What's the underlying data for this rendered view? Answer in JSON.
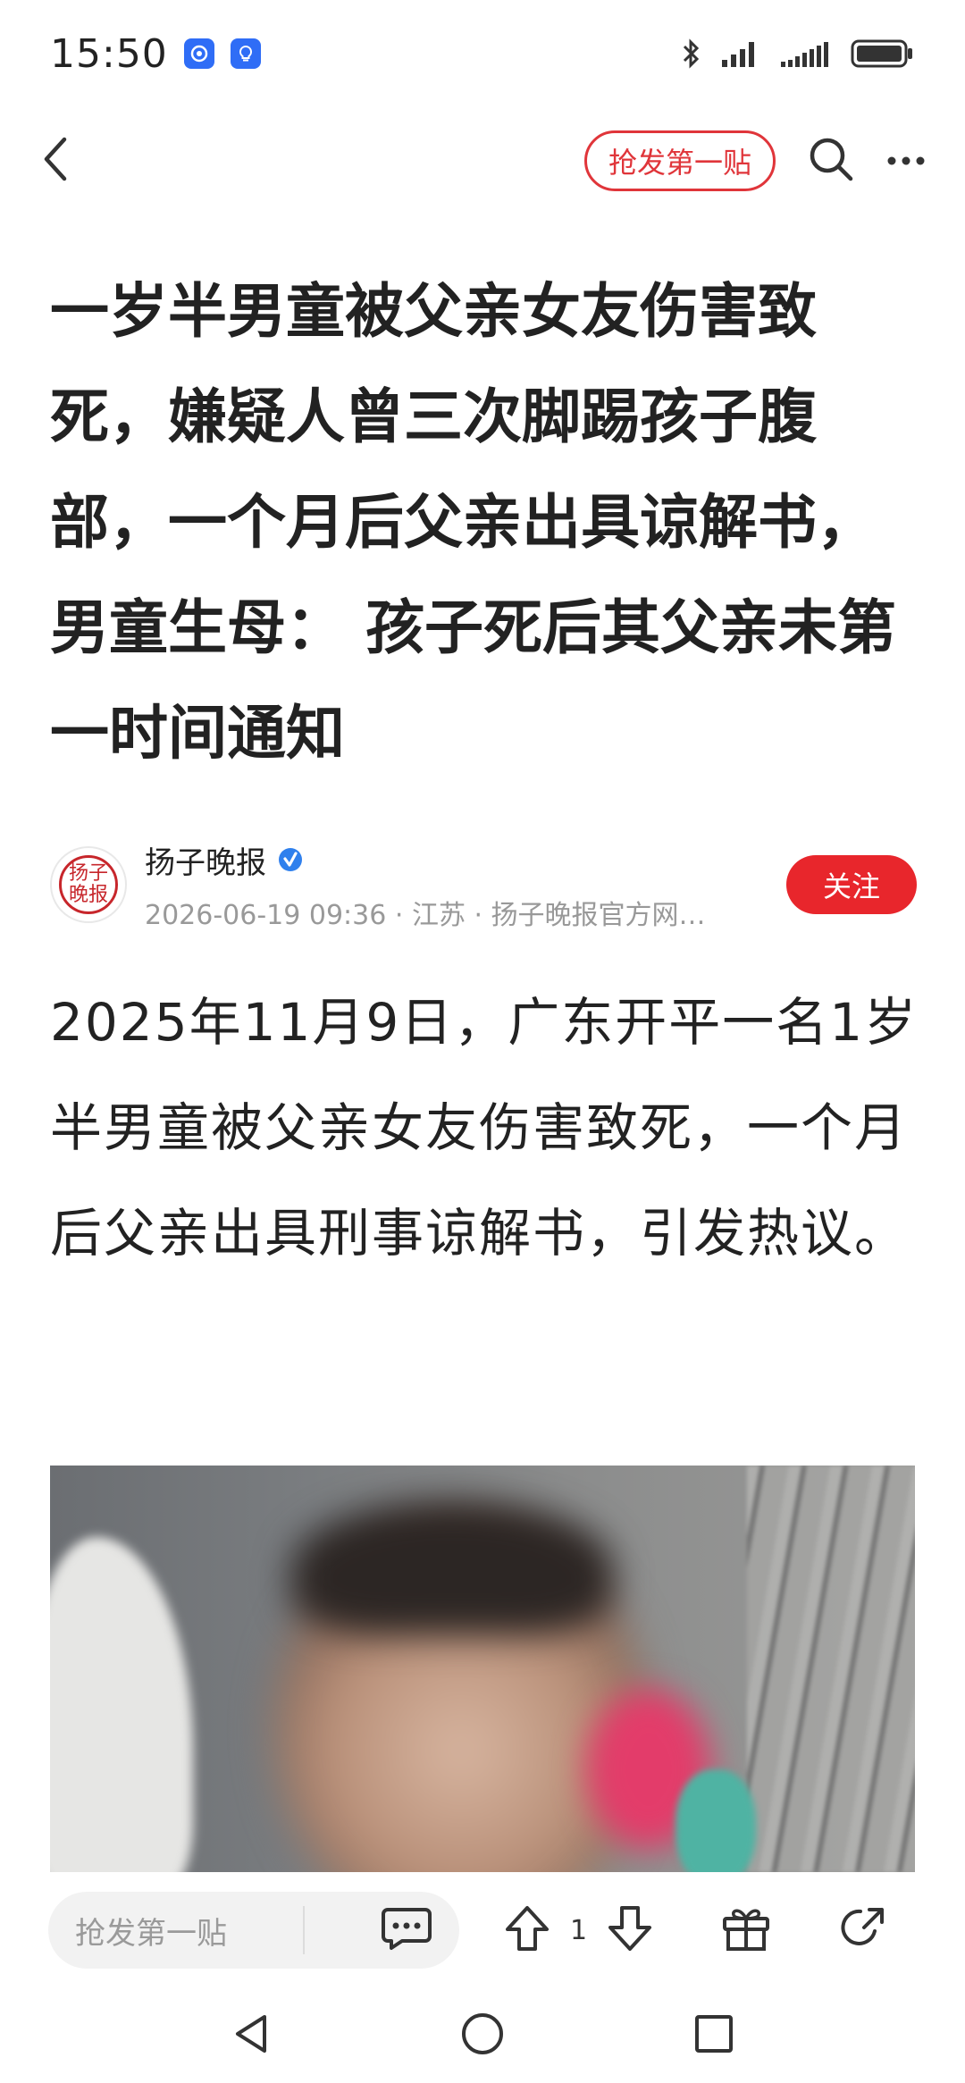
{
  "status_bar": {
    "time": "15:50",
    "left_icons": [
      "app-notification-icon",
      "bulb-notification-icon"
    ],
    "right_icons": [
      "bluetooth-icon",
      "signal-icon",
      "signal-icon",
      "battery-icon"
    ]
  },
  "nav": {
    "first_post_label": "抢发第一贴",
    "icons": [
      "back-icon",
      "search-icon",
      "more-icon"
    ]
  },
  "article": {
    "title": "一岁半男童被父亲女友伤害致死，嫌疑人曾三次脚踢孩子腹部，一个月后父亲出具谅解书，男童生母： 孩子死后其父亲未第一时间通知",
    "author": {
      "name": "扬子晚报",
      "avatar_text": "扬子晚报",
      "verified": true,
      "meta": "2026-06-19 09:36 · 江苏 · 扬子晚报官方网…",
      "follow_label": "关注"
    },
    "body": "2025年11月9日，广东开平一名1岁半男童被父亲女友伤害致死，一个月后父亲出具刑事谅解书，引发热议。"
  },
  "bottom_bar": {
    "comment_placeholder": "抢发第一贴",
    "upvote_count": "1",
    "icons": [
      "comment-icon",
      "upvote-icon",
      "downvote-icon",
      "gift-icon",
      "share-icon"
    ]
  },
  "colors": {
    "accent": "#e8262c",
    "verified": "#2f80ed"
  }
}
